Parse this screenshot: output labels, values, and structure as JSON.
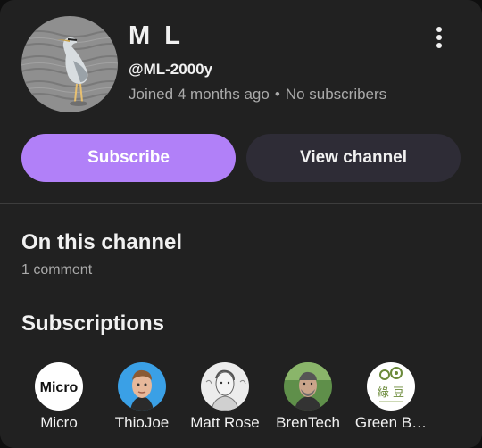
{
  "channel": {
    "name": "M L",
    "handle": "@ML-2000y",
    "joined": "Joined 4 months ago",
    "subscribers": "No subscribers",
    "separator": "•"
  },
  "actions": {
    "subscribe_label": "Subscribe",
    "view_channel_label": "View channel"
  },
  "sections": {
    "on_channel_title": "On this channel",
    "comment_count": "1 comment",
    "subscriptions_title": "Subscriptions"
  },
  "subscriptions": [
    {
      "label": "Micro",
      "avatar_text": "Micro"
    },
    {
      "label": "ThioJoe"
    },
    {
      "label": "Matt Rose"
    },
    {
      "label": "BrenTech"
    },
    {
      "label": "Green B…",
      "avatar_text": "綠 豆"
    }
  ],
  "colors": {
    "card_bg": "#212121",
    "subscribe_bg": "#b180f8",
    "view_channel_bg": "#2e2c36",
    "secondary_text": "#aaaaaa"
  },
  "icons": {
    "menu": "more-vert-icon",
    "avatar": "heron-avatar"
  }
}
